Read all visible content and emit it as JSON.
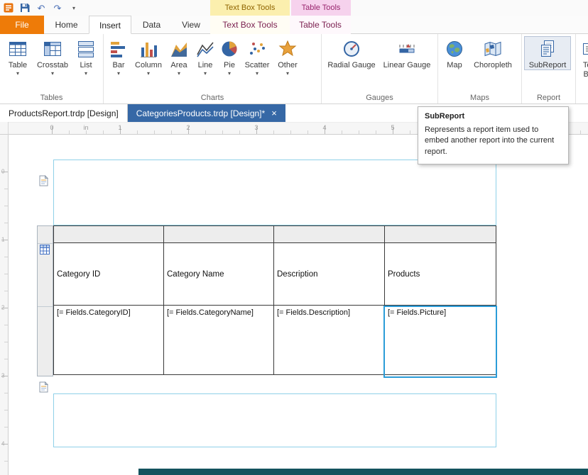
{
  "icons": {
    "dropdown": "▾",
    "undo": "↶",
    "redo": "↷",
    "qat_menu": "▾"
  },
  "ribbon": {
    "file_tab": "File",
    "tabs": [
      {
        "label": "Home"
      },
      {
        "label": "Insert"
      },
      {
        "label": "Data"
      },
      {
        "label": "View"
      }
    ],
    "contextual": {
      "textbox_header": "Text Box Tools",
      "textbox_tab": "Text Box Tools",
      "table_header": "Table Tools",
      "table_tab": "Table Tools"
    },
    "groups": {
      "tables": {
        "label": "Tables",
        "buttons": [
          {
            "label": "Table"
          },
          {
            "label": "Crosstab"
          },
          {
            "label": "List"
          }
        ]
      },
      "charts": {
        "label": "Charts",
        "buttons": [
          {
            "label": "Bar"
          },
          {
            "label": "Column"
          },
          {
            "label": "Area"
          },
          {
            "label": "Line"
          },
          {
            "label": "Pie"
          },
          {
            "label": "Scatter"
          },
          {
            "label": "Other"
          }
        ]
      },
      "gauges": {
        "label": "Gauges",
        "buttons": [
          {
            "label": "Radial Gauge"
          },
          {
            "label": "Linear Gauge"
          }
        ]
      },
      "maps": {
        "label": "Maps",
        "buttons": [
          {
            "label": "Map"
          },
          {
            "label": "Choropleth"
          }
        ]
      },
      "report": {
        "label": "Report",
        "buttons": [
          {
            "label": "SubReport"
          }
        ]
      },
      "clipped": {
        "buttons": [
          {
            "label": "Text Box"
          }
        ]
      }
    }
  },
  "document_tabs": [
    {
      "label": "ProductsReport.trdp [Design]"
    },
    {
      "label": "CategoriesProducts.trdp [Design]*",
      "close": "×"
    }
  ],
  "tooltip": {
    "title": "SubReport",
    "body": "Represents a report item used to embed another report into the current report."
  },
  "rulers": {
    "horizontal": [
      "0",
      "in",
      "1",
      "2",
      "3",
      "4",
      "5"
    ],
    "vertical": [
      "0",
      "1",
      "2",
      "3",
      "4"
    ]
  },
  "canvas": {
    "table": {
      "headers": [
        "Category ID",
        "Category Name",
        "Description",
        "Products"
      ],
      "data_cells": [
        "[= Fields.CategoryID]",
        "[= Fields.CategoryName]",
        "[= Fields.Description]",
        "[= Fields.Picture]"
      ]
    }
  },
  "colors": {
    "file_tab_orange": "#EE7B08",
    "contextual_yellow_bg": "#FBEFAE",
    "contextual_pink_bg": "#F6D2ED",
    "contextual_tab_text": "#7B2150",
    "active_doc_tab_bg": "#3668A6",
    "selection_blue": "#2B9CD8",
    "section_border_blue": "#8FD0E8",
    "bottom_bar_teal": "#14535E"
  }
}
